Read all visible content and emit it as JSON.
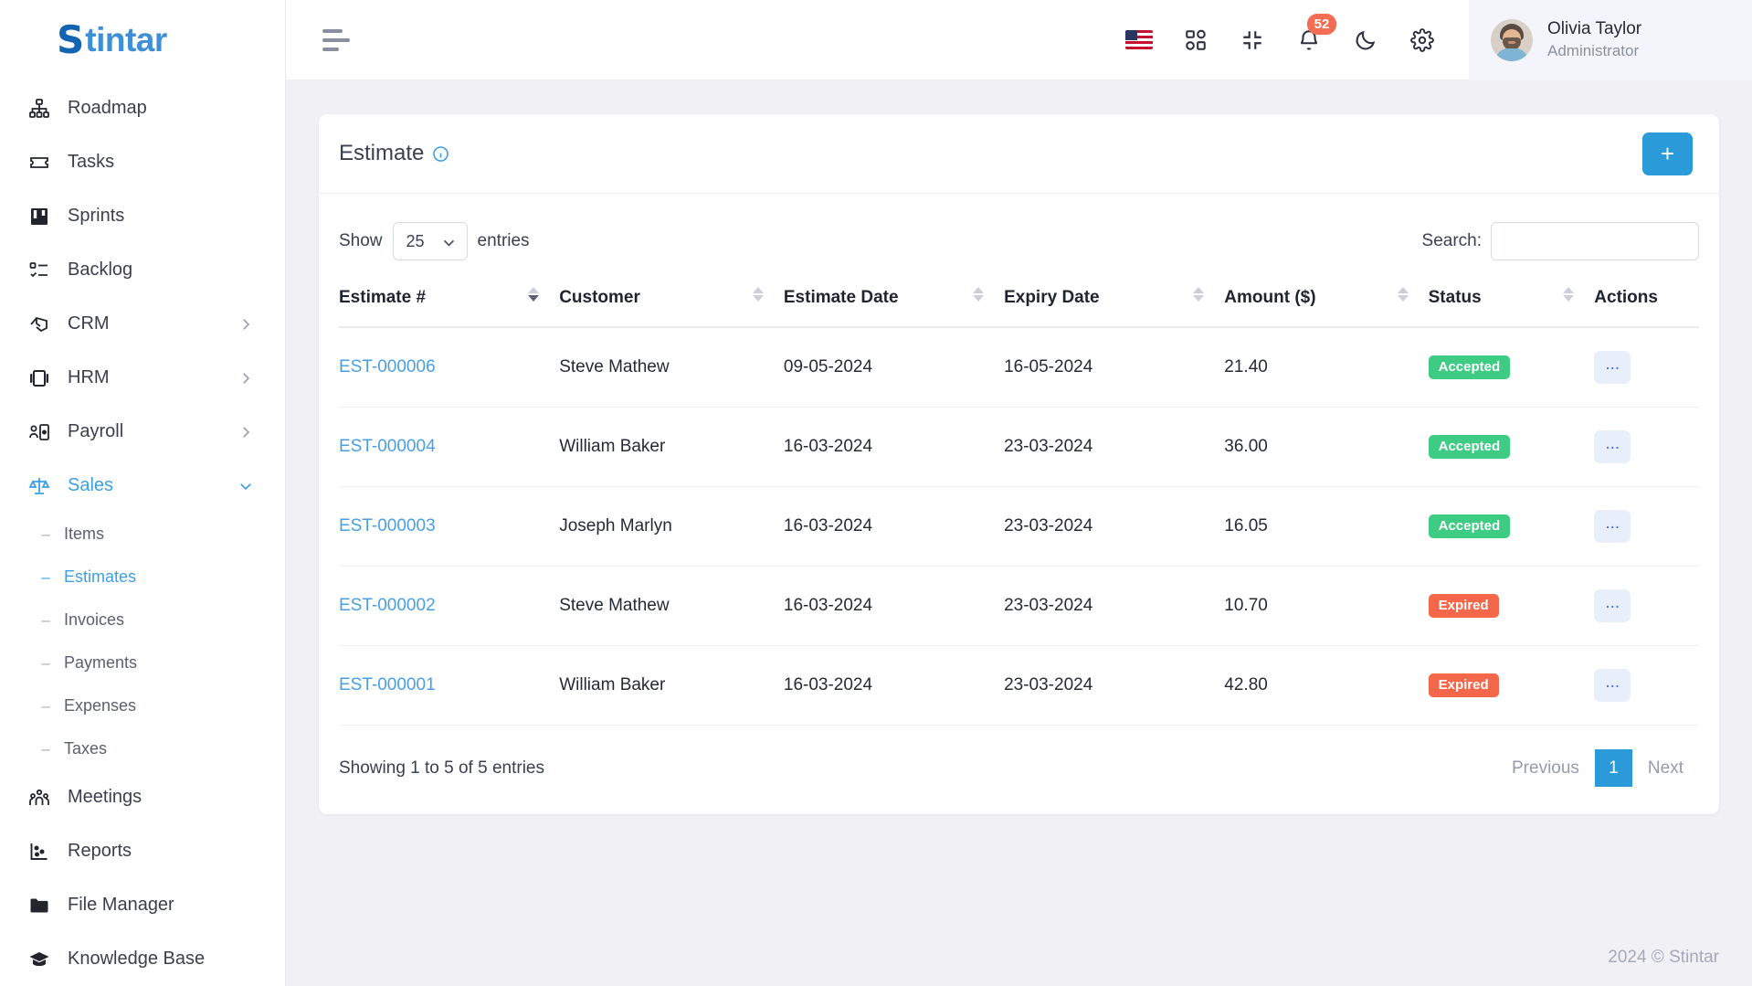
{
  "brand": {
    "initial": "S",
    "rest": "tintar"
  },
  "sidebar": {
    "items": [
      {
        "label": "Roadmap",
        "icon": "sitemap-icon",
        "has_children": false
      },
      {
        "label": "Tasks",
        "icon": "ticket-icon",
        "has_children": false
      },
      {
        "label": "Sprints",
        "icon": "board-icon",
        "has_children": false
      },
      {
        "label": "Backlog",
        "icon": "checklist-icon",
        "has_children": false
      },
      {
        "label": "CRM",
        "icon": "handshake-icon",
        "has_children": true
      },
      {
        "label": "HRM",
        "icon": "id-card-icon",
        "has_children": true
      },
      {
        "label": "Payroll",
        "icon": "user-badge-icon",
        "has_children": true
      },
      {
        "label": "Sales",
        "icon": "scales-icon",
        "has_children": true,
        "expanded": true
      }
    ],
    "sales_children": [
      {
        "label": "Items",
        "active": false
      },
      {
        "label": "Estimates",
        "active": true
      },
      {
        "label": "Invoices",
        "active": false
      },
      {
        "label": "Payments",
        "active": false
      },
      {
        "label": "Expenses",
        "active": false
      },
      {
        "label": "Taxes",
        "active": false
      }
    ],
    "items_after": [
      {
        "label": "Meetings",
        "icon": "people-icon",
        "has_children": false
      },
      {
        "label": "Reports",
        "icon": "scatter-chart-icon",
        "has_children": false
      },
      {
        "label": "File Manager",
        "icon": "folder-icon",
        "has_children": false
      },
      {
        "label": "Knowledge Base",
        "icon": "graduation-cap-icon",
        "has_children": false
      }
    ]
  },
  "topbar": {
    "menu_toggle": "hamburger-icon",
    "language_flag": "us-flag-icon",
    "apps_icon": "grid-apps-icon",
    "fullscreen_icon": "compress-icon",
    "notifications_icon": "bell-icon",
    "notifications_count": "52",
    "theme_icon": "moon-icon",
    "settings_icon": "gear-icon",
    "user": {
      "name": "Olivia Taylor",
      "role": "Administrator"
    }
  },
  "card": {
    "title": "Estimate",
    "info_icon": "info-circle-icon",
    "add_label": "+"
  },
  "controls": {
    "show_label": "Show",
    "entries_label": "entries",
    "page_size": "25",
    "search_label": "Search:",
    "search_value": "",
    "search_placeholder": ""
  },
  "table": {
    "columns": [
      {
        "label": "Estimate #",
        "sortable": true,
        "sorted": true
      },
      {
        "label": "Customer",
        "sortable": true,
        "sorted": false
      },
      {
        "label": "Estimate Date",
        "sortable": true,
        "sorted": false
      },
      {
        "label": "Expiry Date",
        "sortable": true,
        "sorted": false
      },
      {
        "label": "Amount ($)",
        "sortable": true,
        "sorted": false
      },
      {
        "label": "Status",
        "sortable": true,
        "sorted": false
      },
      {
        "label": "Actions",
        "sortable": false,
        "sorted": false
      }
    ],
    "rows": [
      {
        "estimate": "EST-000006",
        "customer": "Steve Mathew",
        "estimate_date": "09-05-2024",
        "expiry_date": "16-05-2024",
        "amount": "21.40",
        "status": "Accepted",
        "status_kind": "accepted",
        "action": "..."
      },
      {
        "estimate": "EST-000004",
        "customer": "William Baker",
        "estimate_date": "16-03-2024",
        "expiry_date": "23-03-2024",
        "amount": "36.00",
        "status": "Accepted",
        "status_kind": "accepted",
        "action": "..."
      },
      {
        "estimate": "EST-000003",
        "customer": "Joseph Marlyn",
        "estimate_date": "16-03-2024",
        "expiry_date": "23-03-2024",
        "amount": "16.05",
        "status": "Accepted",
        "status_kind": "accepted",
        "action": "..."
      },
      {
        "estimate": "EST-000002",
        "customer": "Steve Mathew",
        "estimate_date": "16-03-2024",
        "expiry_date": "23-03-2024",
        "amount": "10.70",
        "status": "Expired",
        "status_kind": "expired",
        "action": "..."
      },
      {
        "estimate": "EST-000001",
        "customer": "William Baker",
        "estimate_date": "16-03-2024",
        "expiry_date": "23-03-2024",
        "amount": "42.80",
        "status": "Expired",
        "status_kind": "expired",
        "action": "..."
      }
    ]
  },
  "pagination": {
    "showing": "Showing 1 to 5 of 5 entries",
    "previous": "Previous",
    "pages": [
      "1"
    ],
    "next": "Next",
    "current": "1"
  },
  "footer": {
    "copyright": "2024 © Stintar"
  },
  "colors": {
    "accent": "#2b9ad9",
    "link": "#4a9fe0",
    "accepted": "#3ecb84",
    "expired": "#f4674a",
    "badge": "#f46c52",
    "sidebar_bg": "#ffffff",
    "page_bg": "#f1f1f5"
  }
}
